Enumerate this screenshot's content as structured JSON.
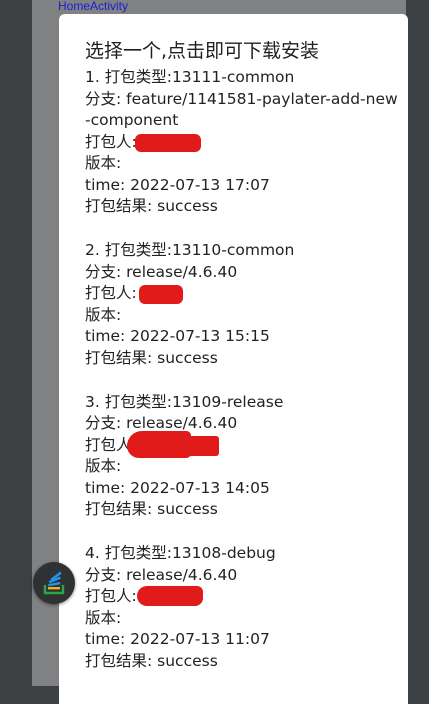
{
  "app": {
    "title": "HomeActivity"
  },
  "dialog": {
    "title": "选择一个,点击即可下载安装",
    "items": [
      {
        "type_line": "1. 打包类型:13111-common",
        "branch_line": "分支: feature/1141581-paylater-add-new-component",
        "packager_line": "打包人:",
        "version_line": "版本:",
        "time_line": "time: 2022-07-13 17:07",
        "result_line": "打包结果: success"
      },
      {
        "type_line": "2. 打包类型:13110-common",
        "branch_line": "分支: release/4.6.40",
        "packager_line": "打包人:",
        "version_line": "版本:",
        "time_line": "time: 2022-07-13 15:15",
        "result_line": "打包结果: success"
      },
      {
        "type_line": "3. 打包类型:13109-release",
        "branch_line": "分支: release/4.6.40",
        "packager_line": "打包人",
        "version_line": "版本:",
        "time_line": "time: 2022-07-13 14:05",
        "result_line": "打包结果: success"
      },
      {
        "type_line": "4. 打包类型:13108-debug",
        "branch_line": "分支: release/4.6.40",
        "packager_line": "打包人:",
        "version_line": "版本:",
        "time_line": "time: 2022-07-13 11:07",
        "result_line": "打包结果: success"
      }
    ]
  },
  "colors": {
    "redaction": "#e11a1a",
    "app_title": "#1a1fd6",
    "dialog_bg": "#ffffff",
    "scrim": "#3d4042"
  },
  "icons": {
    "floating_button": "stack-overflow-icon"
  }
}
